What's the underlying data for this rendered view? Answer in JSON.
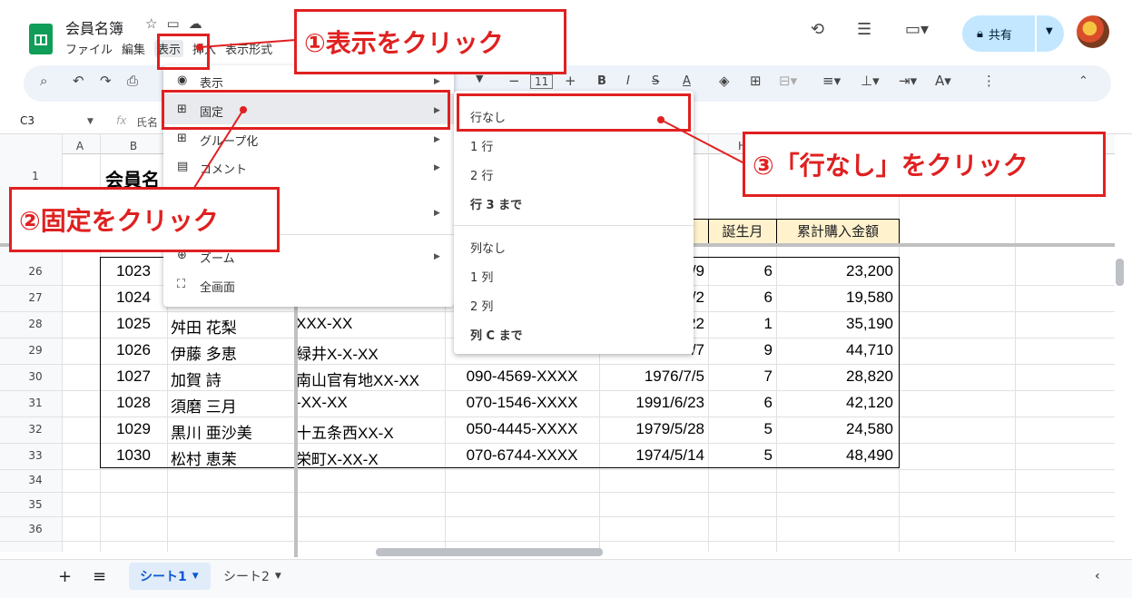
{
  "header": {
    "doc_title": "会員名簿",
    "menus": [
      "ファイル",
      "編集",
      "表示",
      "挿入",
      "表示形式"
    ],
    "share_label": "共有"
  },
  "toolbar": {
    "font_size": "11"
  },
  "formula_bar": {
    "cell_ref": "C3",
    "content": "氏名"
  },
  "columns": [
    "A",
    "B",
    "H"
  ],
  "sheet": {
    "title_cell": "会員名",
    "header_row": {
      "birth_month": "誕生月",
      "total": "累計購入金額"
    },
    "top_rows": [
      {
        "row": "26",
        "id": "1023",
        "date_tail": "/9",
        "month": "6",
        "amount": "23,200"
      },
      {
        "row": "27",
        "id": "1024",
        "date_tail": "/2",
        "month": "6",
        "amount": "19,580"
      },
      {
        "row": "28",
        "id": "1025",
        "name": "舛田 花梨",
        "addr": "XXX-XX",
        "date_tail": "22",
        "month": "1",
        "amount": "35,190"
      },
      {
        "row": "29",
        "id": "1026",
        "name": "伊藤 多恵",
        "addr": "緑井X-X-XX",
        "date_tail": "/7",
        "month": "9",
        "amount": "44,710"
      }
    ],
    "rows": [
      {
        "row": "30",
        "id": "1027",
        "name": "加賀 詩",
        "addr": "南山官有地XX-XX",
        "phone": "090-4569-XXXX",
        "date": "1976/7/5",
        "month": "7",
        "amount": "28,820"
      },
      {
        "row": "31",
        "id": "1028",
        "name": "須磨 三月",
        "addr": "-XX-XX",
        "phone": "070-1546-XXXX",
        "date": "1991/6/23",
        "month": "6",
        "amount": "42,120"
      },
      {
        "row": "32",
        "id": "1029",
        "name": "黒川 亜沙美",
        "addr": "十五条西XX-X",
        "phone": "050-4445-XXXX",
        "date": "1979/5/28",
        "month": "5",
        "amount": "24,580"
      },
      {
        "row": "33",
        "id": "1030",
        "name": "松村 恵茉",
        "addr": "栄町X-XX-X",
        "phone": "070-6744-XXXX",
        "date": "1974/5/14",
        "month": "5",
        "amount": "48,490"
      }
    ],
    "empty_rows": [
      "34",
      "35",
      "36"
    ],
    "row1_label": "1"
  },
  "view_menu": {
    "items": [
      "表示",
      "固定",
      "グループ化",
      "コメント",
      "ズーム",
      "全画面"
    ]
  },
  "freeze_menu": {
    "rows": [
      "行なし",
      "1 行",
      "2 行",
      "行 3 まで"
    ],
    "cols": [
      "列なし",
      "1 列",
      "2 列",
      "列 C まで"
    ]
  },
  "annotations": {
    "step1": "①表示をクリック",
    "step2": "②固定をクリック",
    "step3": "③「行なし」をクリック"
  },
  "tabs": [
    "シート1",
    "シート2"
  ]
}
